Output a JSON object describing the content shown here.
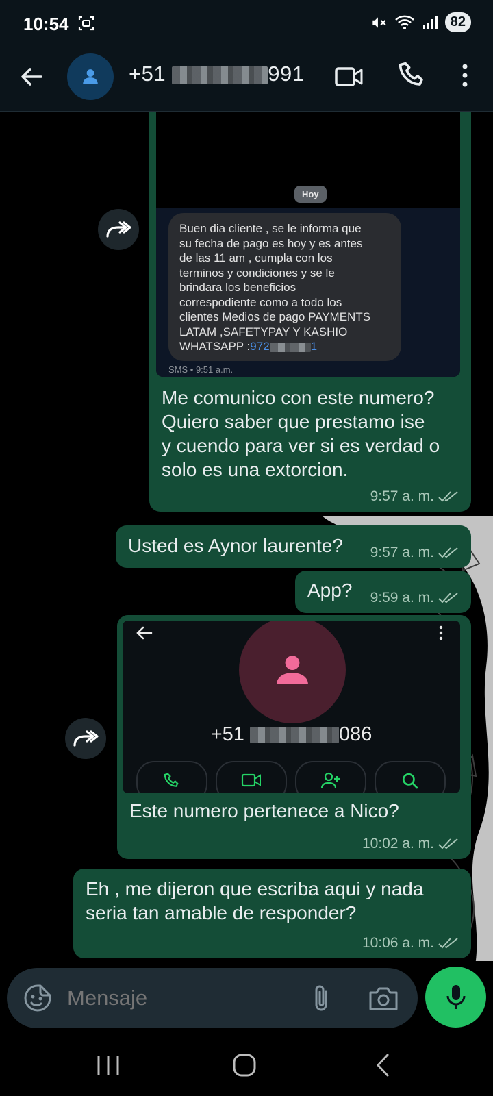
{
  "status_bar": {
    "time": "10:54",
    "battery": "82"
  },
  "header": {
    "contact_prefix": "+51",
    "contact_suffix": "991"
  },
  "messages": {
    "m1": {
      "image": {
        "date_pill": "Hoy",
        "sms_lines": [
          "Buen dia cliente , se le informa que",
          "su fecha de pago es hoy y es antes",
          "de las 11 am , cumpla con los",
          "terminos y condiciones y se le",
          "brindara los beneficios",
          "correspodiente como a todo los",
          "clientes Medios de pago PAYMENTS",
          "LATAM ,SAFETYPAY Y KASHIO"
        ],
        "whatsapp_label": "WHATSAPP :",
        "whatsapp_number_start": "972",
        "whatsapp_number_end": "1",
        "sms_meta": "SMS • 9:51 a.m."
      },
      "text_lines": [
        "Me comunico con este numero?",
        "Quiero saber que prestamo ise",
        "y cuendo para ver si es verdad o",
        "solo es una extorcion."
      ],
      "time": "9:57 a. m."
    },
    "m2": {
      "text": "Usted es Aynor laurente?",
      "time": "9:57 a. m."
    },
    "m3": {
      "text": "App?",
      "time": "9:59 a. m."
    },
    "m4": {
      "image": {
        "number_prefix": "+51",
        "number_suffix": "086"
      },
      "text": "Este numero pertenece a Nico?",
      "time": "10:02 a. m."
    },
    "m5": {
      "text_lines": [
        "Eh , me dijeron que escriba aqui y nada",
        "seria tan amable de responder?"
      ],
      "time": "10:06 a. m."
    }
  },
  "composer": {
    "placeholder": "Mensaje"
  },
  "colors": {
    "outgoing_bubble": "#144d37",
    "mic_button": "#21c063",
    "header_bg": "#0b141a"
  }
}
